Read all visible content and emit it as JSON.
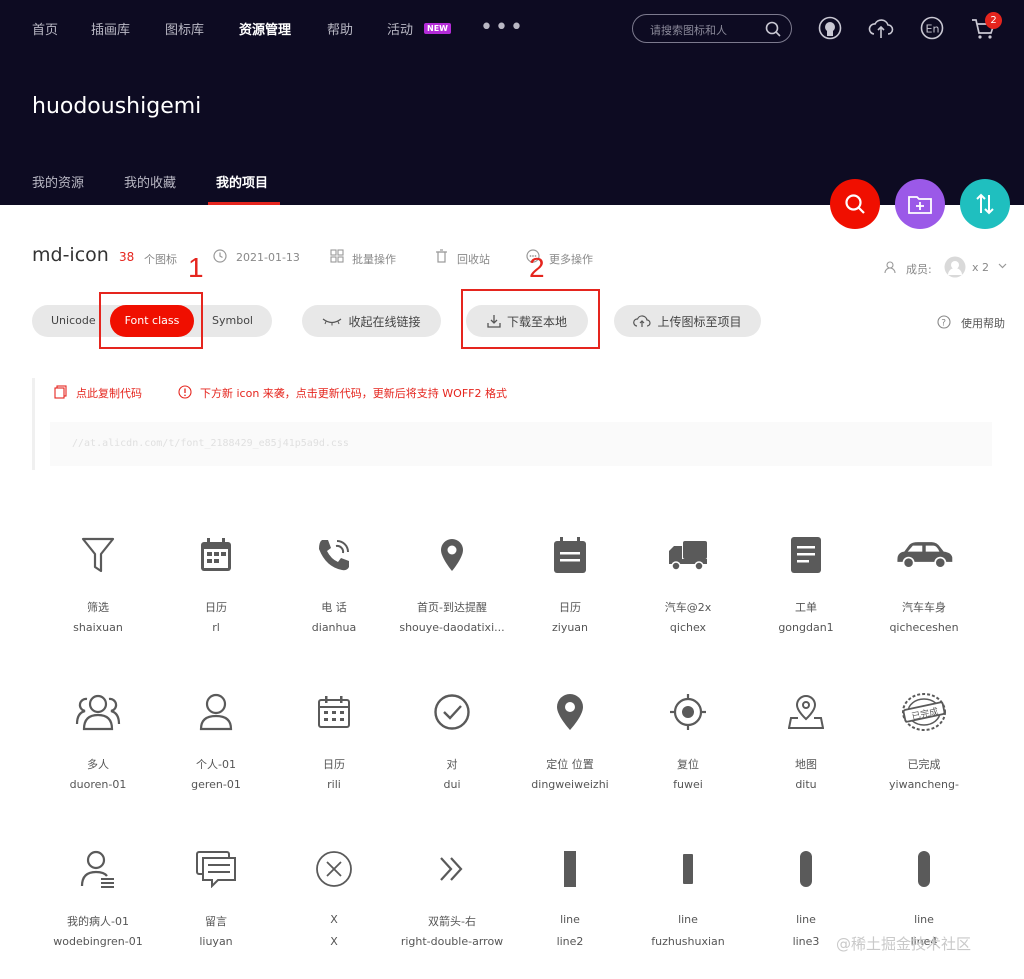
{
  "nav": {
    "items": [
      "首页",
      "插画库",
      "图标库",
      "资源管理",
      "帮助",
      "活动"
    ],
    "new_badge": "NEW",
    "more": "•••",
    "search_placeholder": "请搜索图标和人",
    "cart_count": "2"
  },
  "user": {
    "title": "huodoushigemi"
  },
  "subtabs": [
    "我的资源",
    "我的收藏",
    "我的项目"
  ],
  "project": {
    "name": "md-icon",
    "count": "38",
    "count_suffix": "个图标",
    "date": "2021-01-13",
    "batch": "批量操作",
    "recycle": "回收站",
    "more_ops": "更多操作",
    "members_label": "成员:",
    "members_count": "x 2"
  },
  "annotations": {
    "one": "1",
    "two": "2"
  },
  "toolbar": {
    "unicode": "Unicode",
    "font_class": "Font class",
    "symbol": "Symbol",
    "collapse_link": "收起在线链接",
    "download": "下载至本地",
    "upload": "上传图标至项目",
    "help": "使用帮助"
  },
  "code": {
    "copy": "点此复制代码",
    "warning": "下方新 icon 来袭，点击更新代码，更新后将支持 WOFF2 格式",
    "url": "//at.alicdn.com/t/font_2188429_e85j41p5a9d.css"
  },
  "icons": [
    {
      "name": "筛选",
      "code": "shaixuan",
      "glyph": "filter-icon"
    },
    {
      "name": "日历",
      "code": "rl",
      "glyph": "calendar-icon"
    },
    {
      "name": "电 话",
      "code": "dianhua",
      "glyph": "phone-icon"
    },
    {
      "name": "首页-到达提醒",
      "code": "shouye-daodatixi...",
      "glyph": "location-pin-icon"
    },
    {
      "name": "日历",
      "code": "ziyuan",
      "glyph": "calendar-list-icon"
    },
    {
      "name": "汽车@2x",
      "code": "qichex",
      "glyph": "truck-icon"
    },
    {
      "name": "工单",
      "code": "gongdan1",
      "glyph": "document-icon"
    },
    {
      "name": "汽车车身",
      "code": "qicheceshen",
      "glyph": "car-icon"
    },
    {
      "name": "多人",
      "code": "duoren-01",
      "glyph": "people-icon"
    },
    {
      "name": "个人-01",
      "code": "geren-01",
      "glyph": "person-icon"
    },
    {
      "name": "日历",
      "code": "rili",
      "glyph": "calendar-grid-icon"
    },
    {
      "name": "对",
      "code": "dui",
      "glyph": "check-circle-icon"
    },
    {
      "name": "定位 位置",
      "code": "dingweiweizhi",
      "glyph": "pin-filled-icon"
    },
    {
      "name": "复位",
      "code": "fuwei",
      "glyph": "target-icon"
    },
    {
      "name": "地图",
      "code": "ditu",
      "glyph": "map-pin-icon"
    },
    {
      "name": "已完成",
      "code": "yiwancheng-",
      "glyph": "completed-stamp-icon"
    },
    {
      "name": "我的病人-01",
      "code": "wodebingren-01",
      "glyph": "patient-icon"
    },
    {
      "name": "留言",
      "code": "liuyan",
      "glyph": "message-icon"
    },
    {
      "name": "X",
      "code": "X",
      "glyph": "close-circle-icon"
    },
    {
      "name": "双箭头-右",
      "code": "right-double-arrow",
      "glyph": "double-arrow-right-icon"
    },
    {
      "name": "line",
      "code": "line2",
      "glyph": "line-bar-icon"
    },
    {
      "name": "line",
      "code": "fuzhushuxian",
      "glyph": "line-short-icon"
    },
    {
      "name": "line",
      "code": "line3",
      "glyph": "line-round-icon"
    },
    {
      "name": "line",
      "code": "line4",
      "glyph": "line-round-icon"
    }
  ],
  "watermark": "@稀土掘金技术社区",
  "colors": {
    "header_bg": "#0d0b22",
    "accent": "#f00f00",
    "fab_search": "#f00f00",
    "fab_folder": "#9b59e8",
    "fab_sort": "#1fbfbf"
  }
}
